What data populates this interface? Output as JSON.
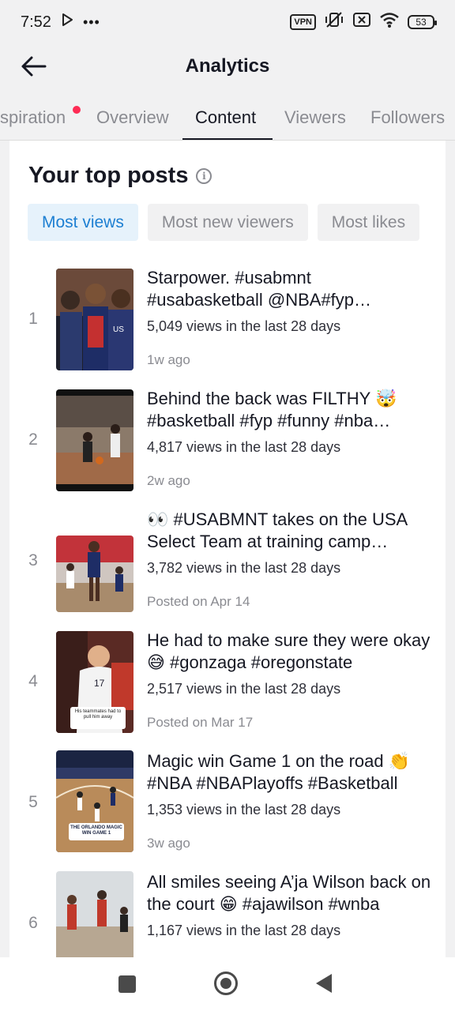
{
  "status_bar": {
    "time": "7:52",
    "vpn": "VPN",
    "battery": "53",
    "icons": [
      "play-icon",
      "more-dots-icon",
      "vpn-icon",
      "mute-vibrate-icon",
      "screen-off-icon",
      "wifi-icon",
      "battery-icon"
    ]
  },
  "header": {
    "title": "Analytics",
    "back_icon": "arrow-left-icon"
  },
  "tabs": [
    {
      "label": "Inspiration",
      "visible_label": "spiration",
      "has_dot": true
    },
    {
      "label": "Overview"
    },
    {
      "label": "Content",
      "active": true
    },
    {
      "label": "Viewers"
    },
    {
      "label": "Followers"
    }
  ],
  "section": {
    "title": "Your top posts",
    "info_icon": "info-icon"
  },
  "filters": [
    {
      "label": "Most views",
      "active": true
    },
    {
      "label": "Most new viewers"
    },
    {
      "label": "Most likes"
    }
  ],
  "posts": [
    {
      "rank": "1",
      "caption": "Starpower. #usabmnt #usabasketball @NBA#fyp #basketball",
      "views": "5,049 views in the last 28 days",
      "posted": "1w ago"
    },
    {
      "rank": "2",
      "caption": "Behind the back was FILTHY 🤯 #basketball #fyp #funny #nba #hoops",
      "views": "4,817 views in the last 28 days",
      "posted": "2w ago"
    },
    {
      "rank": "3",
      "caption": "👀 #USABMNT takes on the USA Select Team at training camp #usabasketball",
      "views": "3,782 views in the last 28 days",
      "posted": "Posted on Apr 14"
    },
    {
      "rank": "4",
      "caption": "He had to make sure they were okay 😅 #gonzaga #oregonstate",
      "views": "2,517 views in the last 28 days",
      "posted": "Posted on Mar 17"
    },
    {
      "rank": "5",
      "caption": "Magic win Game 1 on the road 👏 #NBA #NBAPlayoffs #Basketball",
      "views": "1,353 views in the last 28 days",
      "posted": "3w ago"
    },
    {
      "rank": "6",
      "caption": "All smiles seeing A’ja Wilson back on the court 😁 #ajawilson #wnba",
      "views": "1,167 views in the last 28 days",
      "posted": ""
    }
  ],
  "thumb_text": {
    "post4": "His teammates had to pull him away",
    "post5": "THE ORLANDO MAGIC WIN GAME 1"
  },
  "nav": {
    "recents_icon": "square-recents-icon",
    "home_icon": "circle-home-icon",
    "back_icon": "triangle-back-icon"
  },
  "colors": {
    "accent_blue": "#1d7fd2",
    "chip_active_bg": "#e6f2fb",
    "notification_red": "#fe2c55",
    "text_primary": "#161823",
    "text_secondary": "#8a8b91"
  }
}
